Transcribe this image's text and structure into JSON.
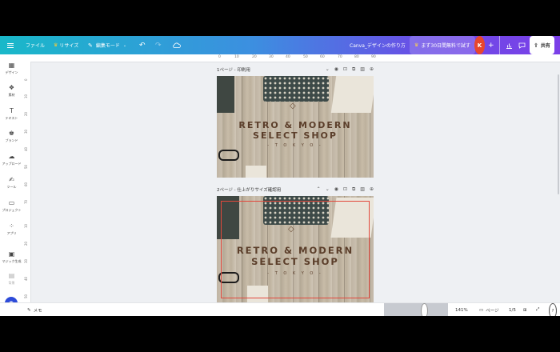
{
  "topbar": {
    "file": "ファイル",
    "resize": "リサイズ",
    "edit_mode": "編集モード",
    "doc_title": "Canva_デザインの作り方",
    "trial": "まず30日間無料で試す",
    "avatar_initial": "K",
    "share": "共有"
  },
  "sidebar": {
    "items": [
      {
        "label": "デザイン",
        "icon": "layout-icon"
      },
      {
        "label": "素材",
        "icon": "elements-icon"
      },
      {
        "label": "テキスト",
        "icon": "text-icon"
      },
      {
        "label": "ブランド",
        "icon": "brand-icon"
      },
      {
        "label": "アップロード",
        "icon": "upload-icon"
      },
      {
        "label": "ツール",
        "icon": "draw-icon"
      },
      {
        "label": "プロジェクト",
        "icon": "folder-icon"
      },
      {
        "label": "アプリ",
        "icon": "apps-icon"
      },
      {
        "label": "マジック生成",
        "icon": "magic-media-icon"
      },
      {
        "label": "背景",
        "icon": "background-icon"
      }
    ]
  },
  "ruler_h": [
    "0",
    "10",
    "20",
    "30",
    "40",
    "50",
    "60",
    "70",
    "80",
    "90"
  ],
  "ruler_v": [
    "0",
    "10",
    "20",
    "30",
    "40",
    "50",
    "60",
    "70",
    "10",
    "20",
    "30",
    "40",
    "50"
  ],
  "pages": [
    {
      "header": "1ページ - 印刷用",
      "line1": "RETRO & MODERN",
      "line2": "SELECT SHOP",
      "line3": "- T O K Y O -"
    },
    {
      "header": "2ページ - 仕上がりサイズ確認用",
      "line1": "RETRO & MODERN",
      "line2": "SELECT SHOP",
      "line3": "- T O K Y O -"
    }
  ],
  "bottombar": {
    "memo": "メモ",
    "zoom": "141%",
    "zoom_fraction": 0.62,
    "pages_label": "ページ",
    "page_count": "1/5"
  },
  "colors": {
    "accent": "#7b3fe8",
    "avatar": "#e8462d",
    "bleed_line": "#e2483c",
    "title_text": "#5b3e2a"
  }
}
